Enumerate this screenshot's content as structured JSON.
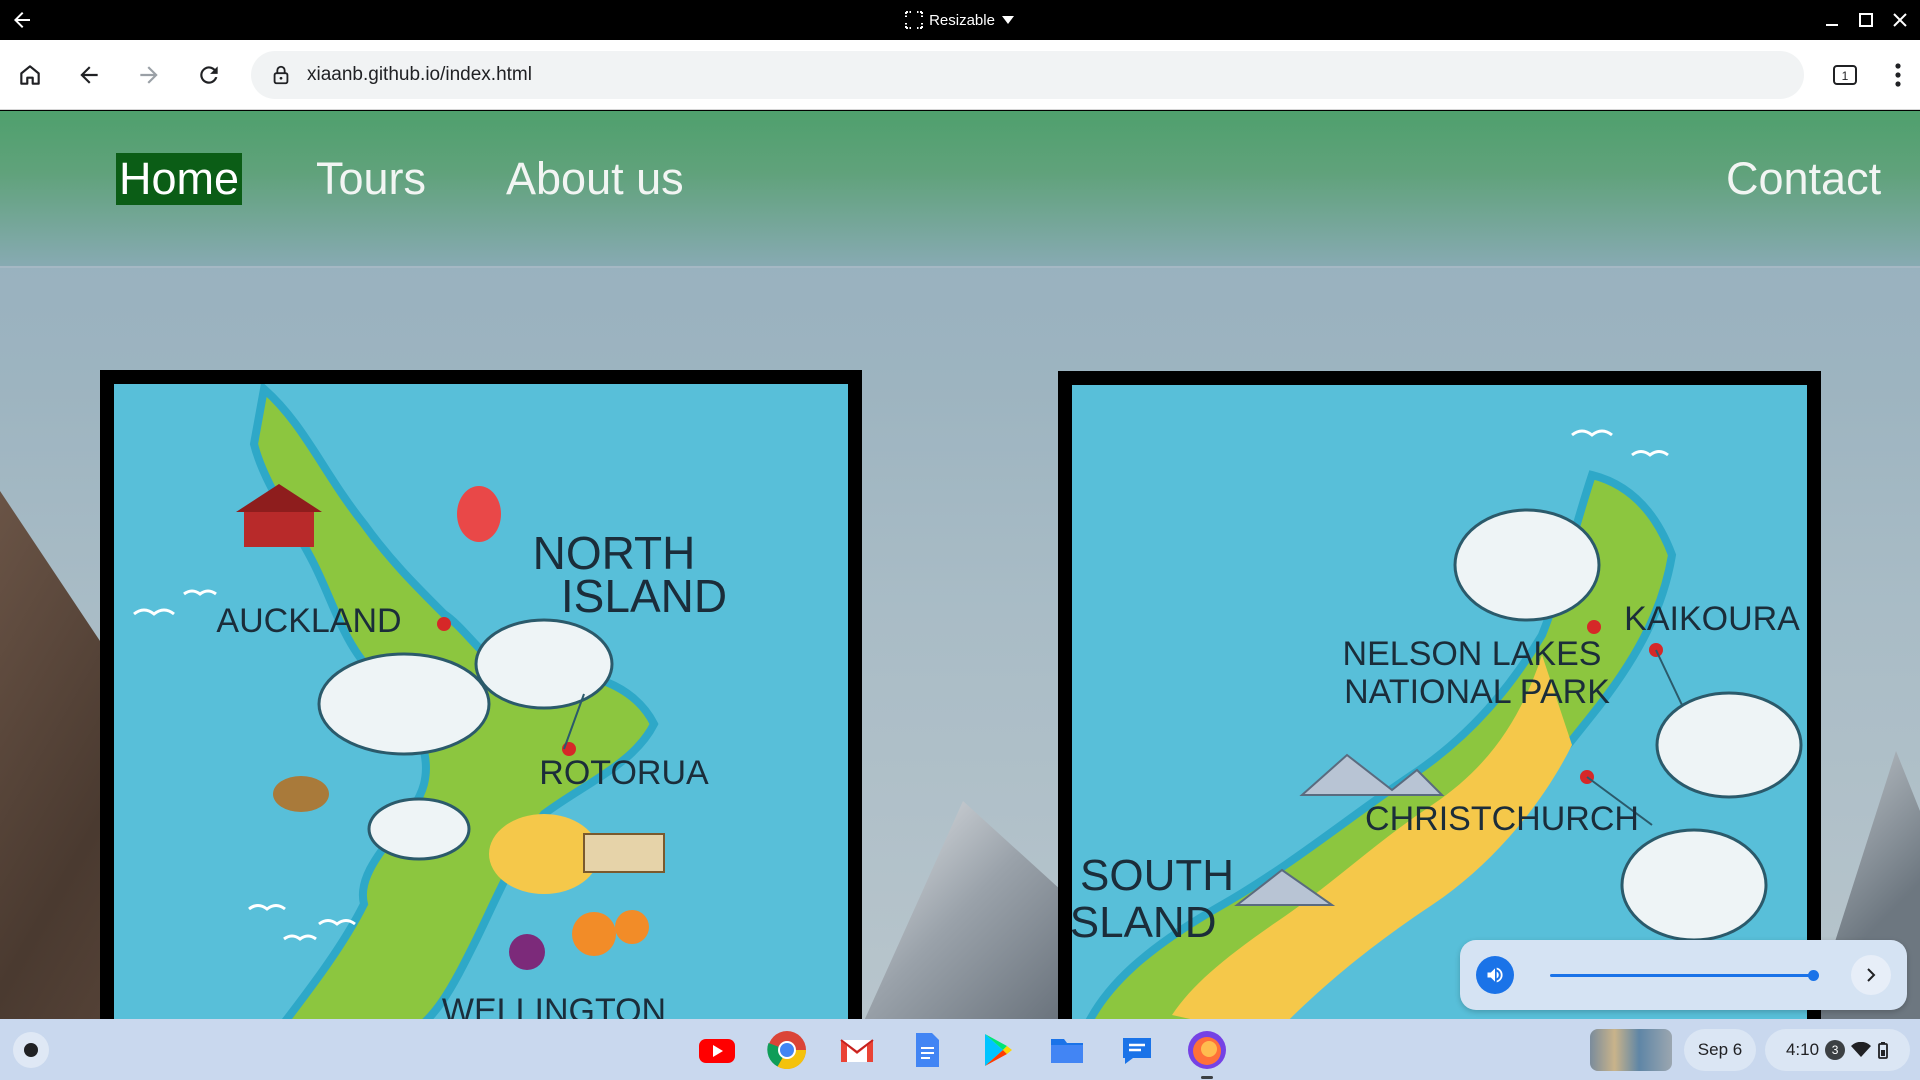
{
  "window": {
    "title": "Resizable"
  },
  "browser": {
    "url": "xiaanb.github.io/index.html",
    "tab_count": "1"
  },
  "nav": {
    "items": [
      {
        "label": "Home",
        "active": true
      },
      {
        "label": "Tours",
        "active": false
      },
      {
        "label": "About us",
        "active": false
      },
      {
        "label": "Contact",
        "active": false
      }
    ]
  },
  "maps": {
    "north": {
      "heading": "NORTH ISLAND",
      "heading_line1": "NORTH",
      "heading_line2": "ISLAND",
      "places": [
        "AUCKLAND",
        "ROTORUA",
        "WELLINGTON"
      ]
    },
    "south": {
      "heading": "SOUTH ISLAND",
      "heading_line1": "SOUTH",
      "heading_line2": "ISLAND",
      "places": [
        "NELSON LAKES NATIONAL PARK",
        "KAIKOURA",
        "CHRISTCHURCH"
      ],
      "nelson_line1": "NELSON LAKES",
      "nelson_line2": "NATIONAL PARK"
    }
  },
  "volume": {
    "level_percent": 100
  },
  "shelf": {
    "apps": [
      "youtube",
      "chrome",
      "gmail",
      "docs",
      "play-store",
      "files",
      "messages",
      "firefox"
    ],
    "date": "Sep 6",
    "time": "4:10",
    "notification_count": "3"
  },
  "colors": {
    "nav_active": "#0b5d16",
    "sea": "#58bfd9",
    "land": "#8cc63f",
    "accent": "#1a73e8"
  }
}
